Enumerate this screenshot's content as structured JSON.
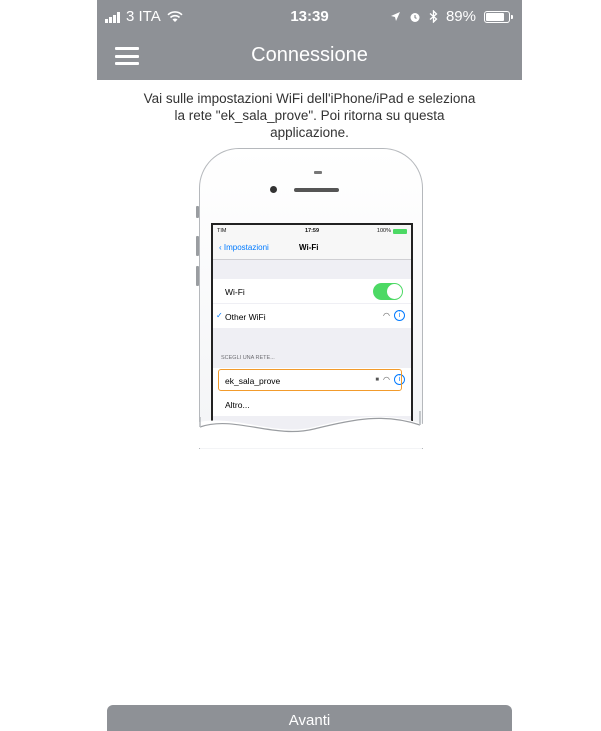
{
  "status_bar": {
    "carrier": "3 ITA",
    "time": "13:39",
    "battery": "89%",
    "battery_level": 0.89
  },
  "nav": {
    "title": "Connessione"
  },
  "instructions": "Vai sulle impostazioni WiFi dell'iPhone/iPad e seleziona la rete \"ek_sala_prove\". Poi ritorna su questa applicazione.",
  "illustration": {
    "status": {
      "carrier": "TIM",
      "time": "17:59",
      "battery": "100%"
    },
    "nav": {
      "back": "Impostazioni",
      "title": "Wi-Fi"
    },
    "wifi_label": "Wi-Fi",
    "current_network": "Other WiFi",
    "section_header": "SCEGLI UNA RETE...",
    "target_network": "ek_sala_prove",
    "other": "Altro..."
  },
  "next_button": "Avanti",
  "colors": {
    "bar": "#8e9196",
    "accent": "#007aff",
    "highlight": "#f29b2c",
    "toggle_on": "#4cd964"
  }
}
